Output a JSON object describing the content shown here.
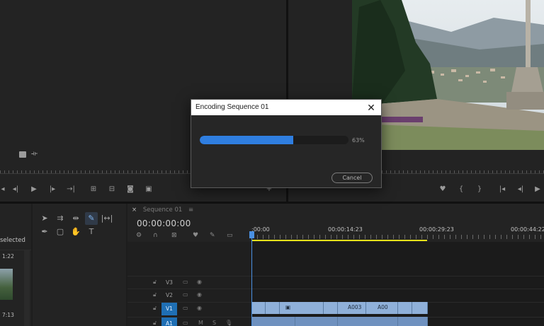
{
  "colors": {
    "accent": "#2f7ee0",
    "workarea": "#e6e21a",
    "playhead": "#4a90e2",
    "target_track": "#1f6fb4"
  },
  "dialog": {
    "title": "Encoding Sequence 01",
    "close_icon": "close-icon",
    "progress_fraction": 0.63,
    "progress_text": "63%",
    "cancel_label": "Cancel"
  },
  "project": {
    "selected_text": "selected",
    "thumb_times": [
      "1:22",
      "7:13"
    ]
  },
  "timeline": {
    "tab_label": "Sequence 01",
    "tab_close": "×",
    "tab_menu": "≡",
    "timecode": "00:00:00:00",
    "ruler_labels": [
      ":00:00",
      "00:00:14:23",
      "00:00:29:23",
      "00:00:44:22"
    ],
    "tracks": [
      {
        "name": "V3",
        "targeted": false
      },
      {
        "name": "V2",
        "targeted": false
      },
      {
        "name": "V1",
        "targeted": true
      },
      {
        "name": "A1",
        "targeted": true
      }
    ],
    "clip_labels": [
      "A003",
      "A00"
    ]
  },
  "icons": {
    "source_controls": [
      "mark-in-icon",
      "step-back-icon",
      "play-icon",
      "step-forward-icon",
      "mark-out-icon",
      "insert-icon",
      "overwrite-icon",
      "export-frame-icon",
      "compare-icon",
      "add-icon"
    ],
    "program_controls": [
      "marker-icon",
      "mark-in-icon",
      "mark-out-icon",
      "go-to-in-icon",
      "step-back-icon"
    ],
    "tools": [
      "selection-tool-icon",
      "track-select-icon",
      "ripple-edit-icon",
      "razor-tool-icon",
      "slip-tool-icon",
      "pen-tool-icon",
      "rectangle-tool-icon",
      "hand-tool-icon",
      "type-tool-icon"
    ]
  }
}
